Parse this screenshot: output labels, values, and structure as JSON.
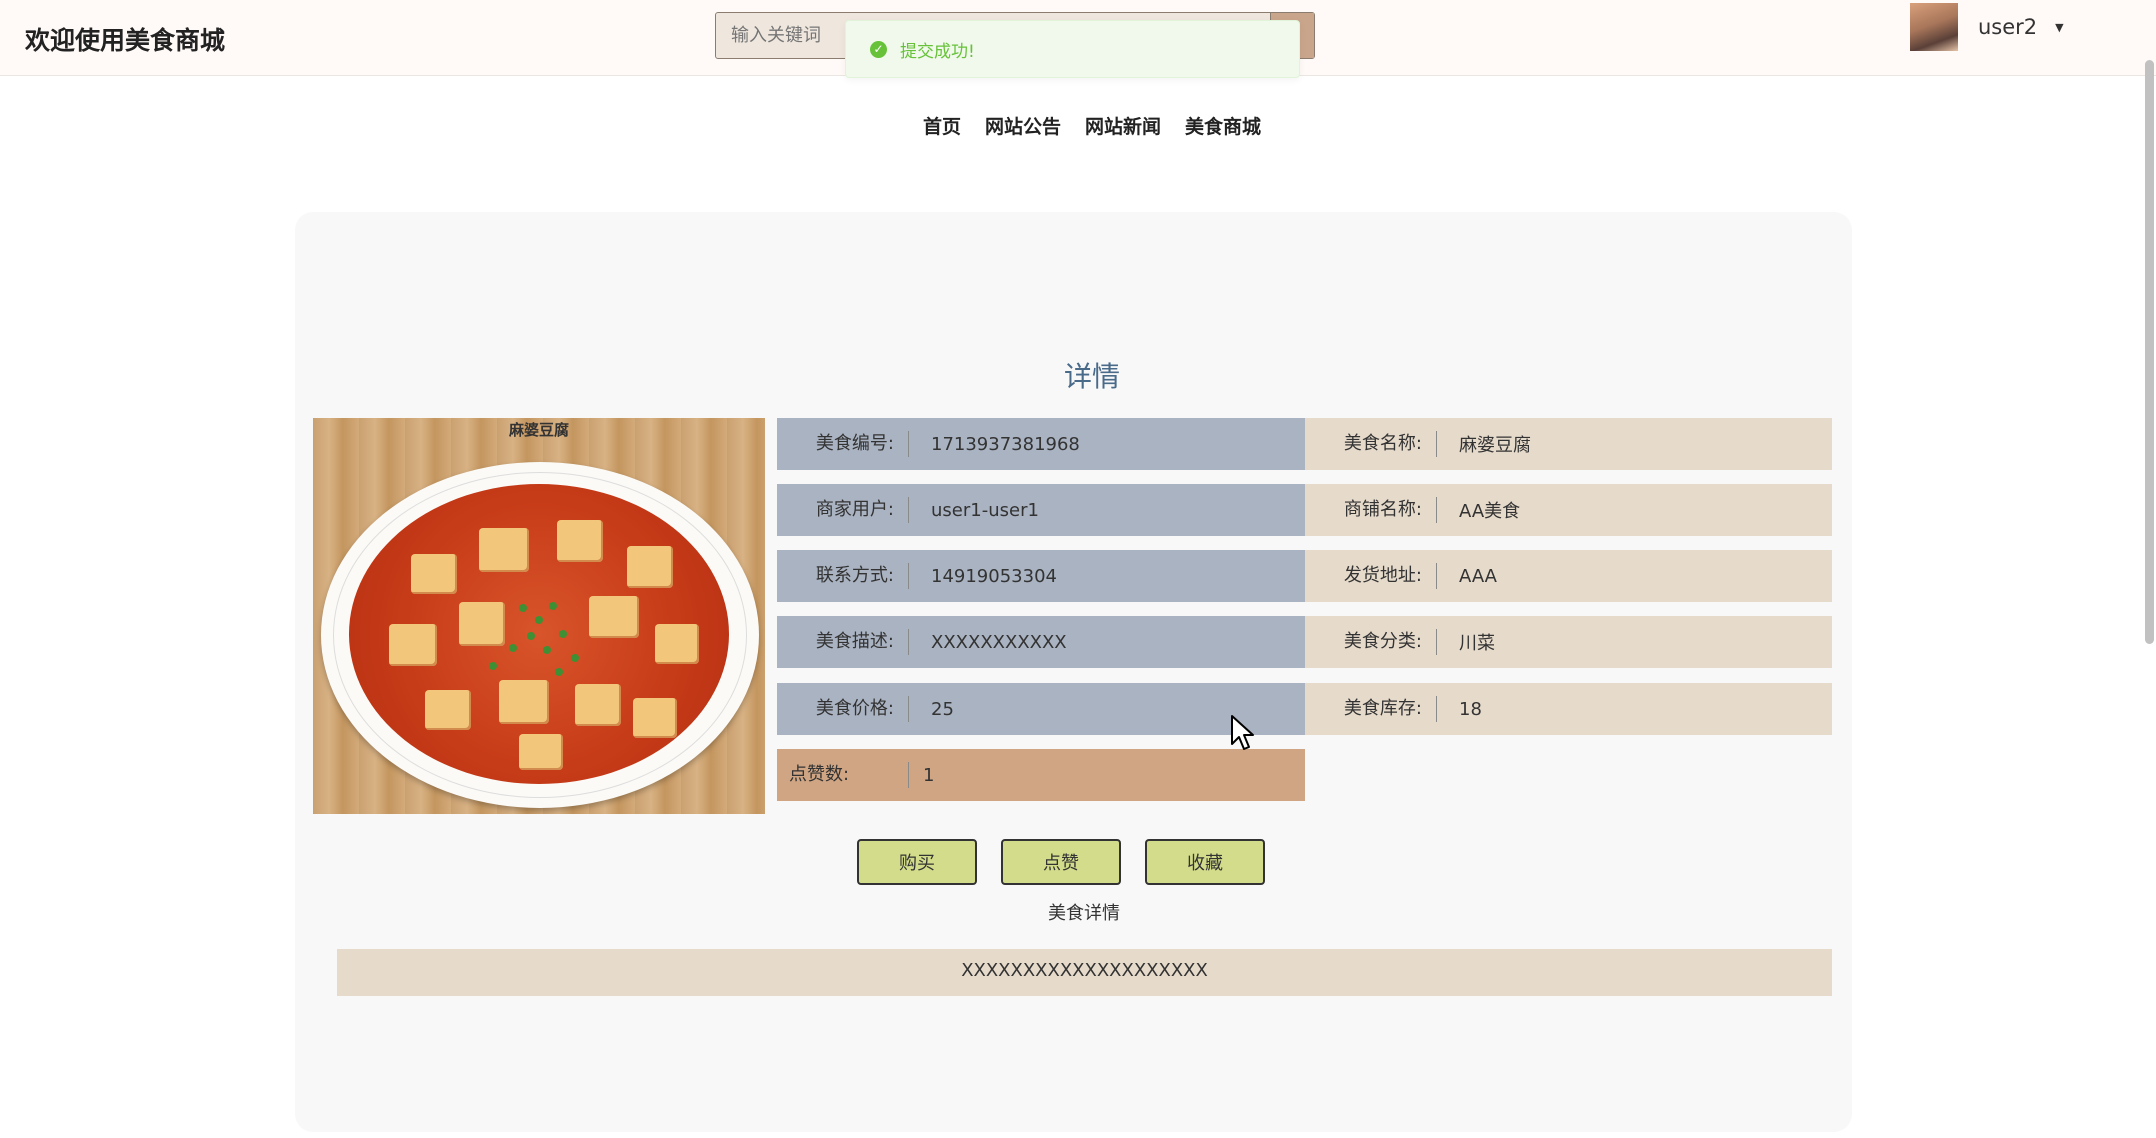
{
  "header": {
    "site_title": "欢迎使用美食商城",
    "search_placeholder": "输入关键词",
    "username": "user2"
  },
  "toast": {
    "message": "提交成功!"
  },
  "nav": {
    "items": [
      {
        "label": "首页"
      },
      {
        "label": "网站公告"
      },
      {
        "label": "网站新闻"
      },
      {
        "label": "美食商城"
      }
    ]
  },
  "detail": {
    "heading": "详情",
    "image_caption": "麻婆豆腐",
    "fields": {
      "food_no": {
        "label": "美食编号:",
        "value": "1713937381968"
      },
      "food_name": {
        "label": "美食名称:",
        "value": "麻婆豆腐"
      },
      "merchant": {
        "label": "商家用户:",
        "value": "user1-user1"
      },
      "shop_name": {
        "label": "商铺名称:",
        "value": "AA美食"
      },
      "contact": {
        "label": "联系方式:",
        "value": "14919053304"
      },
      "ship_address": {
        "label": "发货地址:",
        "value": "AAA"
      },
      "description": {
        "label": "美食描述:",
        "value": "XXXXXXXXXXX"
      },
      "category": {
        "label": "美食分类:",
        "value": "川菜"
      },
      "price": {
        "label": "美食价格:",
        "value": "25"
      },
      "stock": {
        "label": "美食库存:",
        "value": "18"
      },
      "likes": {
        "label": "点赞数:",
        "value": "1"
      }
    },
    "buttons": {
      "buy": "购买",
      "like": "点赞",
      "favorite": "收藏"
    },
    "section_title": "美食详情",
    "section_content": "XXXXXXXXXXXXXXXXXXXX"
  },
  "colors": {
    "blue_cell": "#aab3c2",
    "beige_cell": "#e6dacb",
    "tan_cell": "#cfa583",
    "button_bg": "#d3dc8a",
    "toast_green": "#67c23a",
    "heading": "#4a6a8a"
  }
}
